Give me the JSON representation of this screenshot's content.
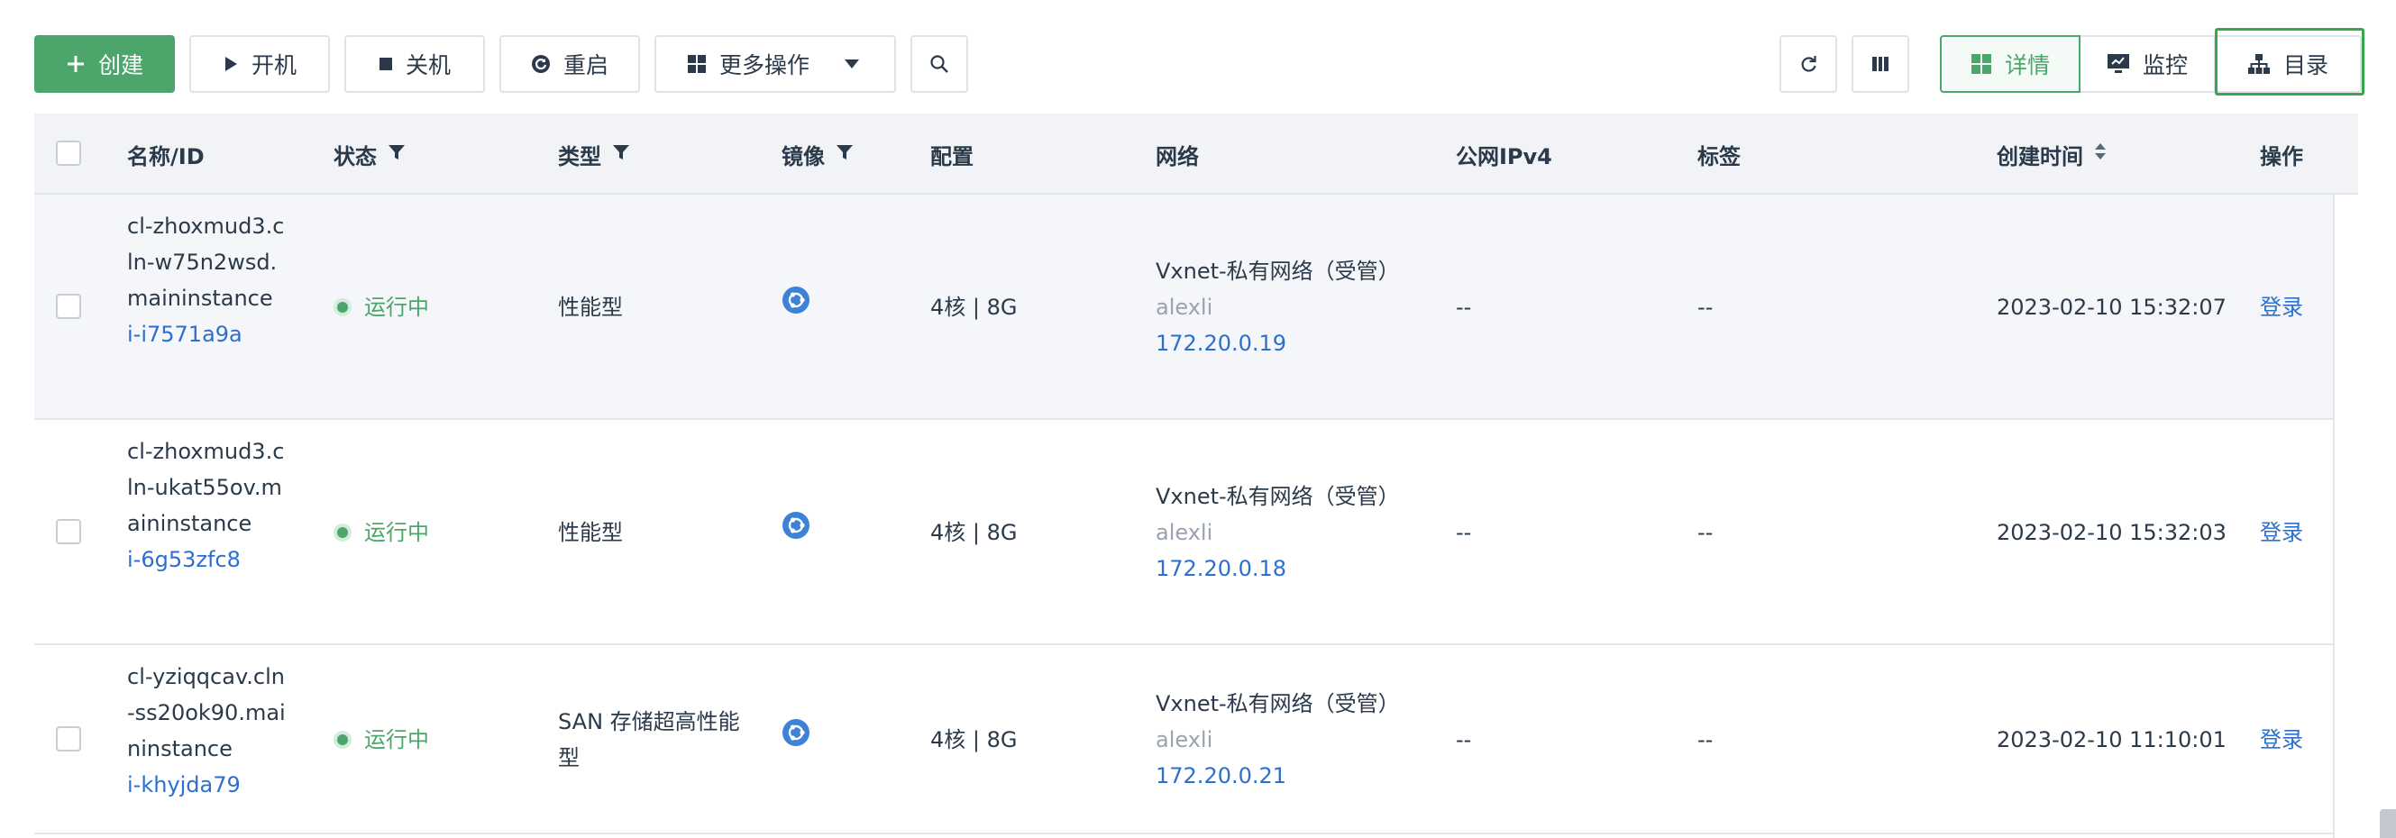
{
  "toolbar": {
    "create_label": "创建",
    "start_label": "开机",
    "stop_label": "关机",
    "restart_label": "重启",
    "more_label": "更多操作",
    "view_tabs": {
      "detail": "详情",
      "monitor": "监控",
      "catalog": "目录"
    }
  },
  "table": {
    "columns": {
      "name": "名称/ID",
      "status": "状态",
      "type": "类型",
      "image": "镜像",
      "config": "配置",
      "network": "网络",
      "ipv4": "公网IPv4",
      "tags": "标签",
      "created": "创建时间",
      "actions": "操作"
    },
    "rows": [
      {
        "name": "cl-zhoxmud3.cln-w75n2wsd.maininstance",
        "id": "i-i7571a9a",
        "status": "运行中",
        "type": "性能型",
        "image_icon": "ubuntu-icon",
        "config": "4核 | 8G",
        "network": "Vxnet-私有网络（受管）",
        "owner": "alexli",
        "ip": "172.20.0.19",
        "ipv4": "--",
        "tags": "--",
        "created": "2023-02-10 15:32:07",
        "action": "登录"
      },
      {
        "name": "cl-zhoxmud3.cln-ukat55ov.maininstance",
        "id": "i-6g53zfc8",
        "status": "运行中",
        "type": "性能型",
        "image_icon": "ubuntu-icon",
        "config": "4核 | 8G",
        "network": "Vxnet-私有网络（受管）",
        "owner": "alexli",
        "ip": "172.20.0.18",
        "ipv4": "--",
        "tags": "--",
        "created": "2023-02-10 15:32:03",
        "action": "登录"
      },
      {
        "name": "cl-yziqqcav.cln-ss20ok90.maininstance",
        "id": "i-khyjda79",
        "status": "运行中",
        "type": "SAN 存储超高性能型",
        "image_icon": "ubuntu-icon",
        "config": "4核 | 8G",
        "network": "Vxnet-私有网络（受管）",
        "owner": "alexli",
        "ip": "172.20.0.21",
        "ipv4": "--",
        "tags": "--",
        "created": "2023-02-10 11:10:01",
        "action": "登录"
      }
    ]
  },
  "colors": {
    "accent_green": "#4ca56a",
    "link_blue": "#2e6fcd",
    "ubuntu_blue": "#3d82d6"
  }
}
